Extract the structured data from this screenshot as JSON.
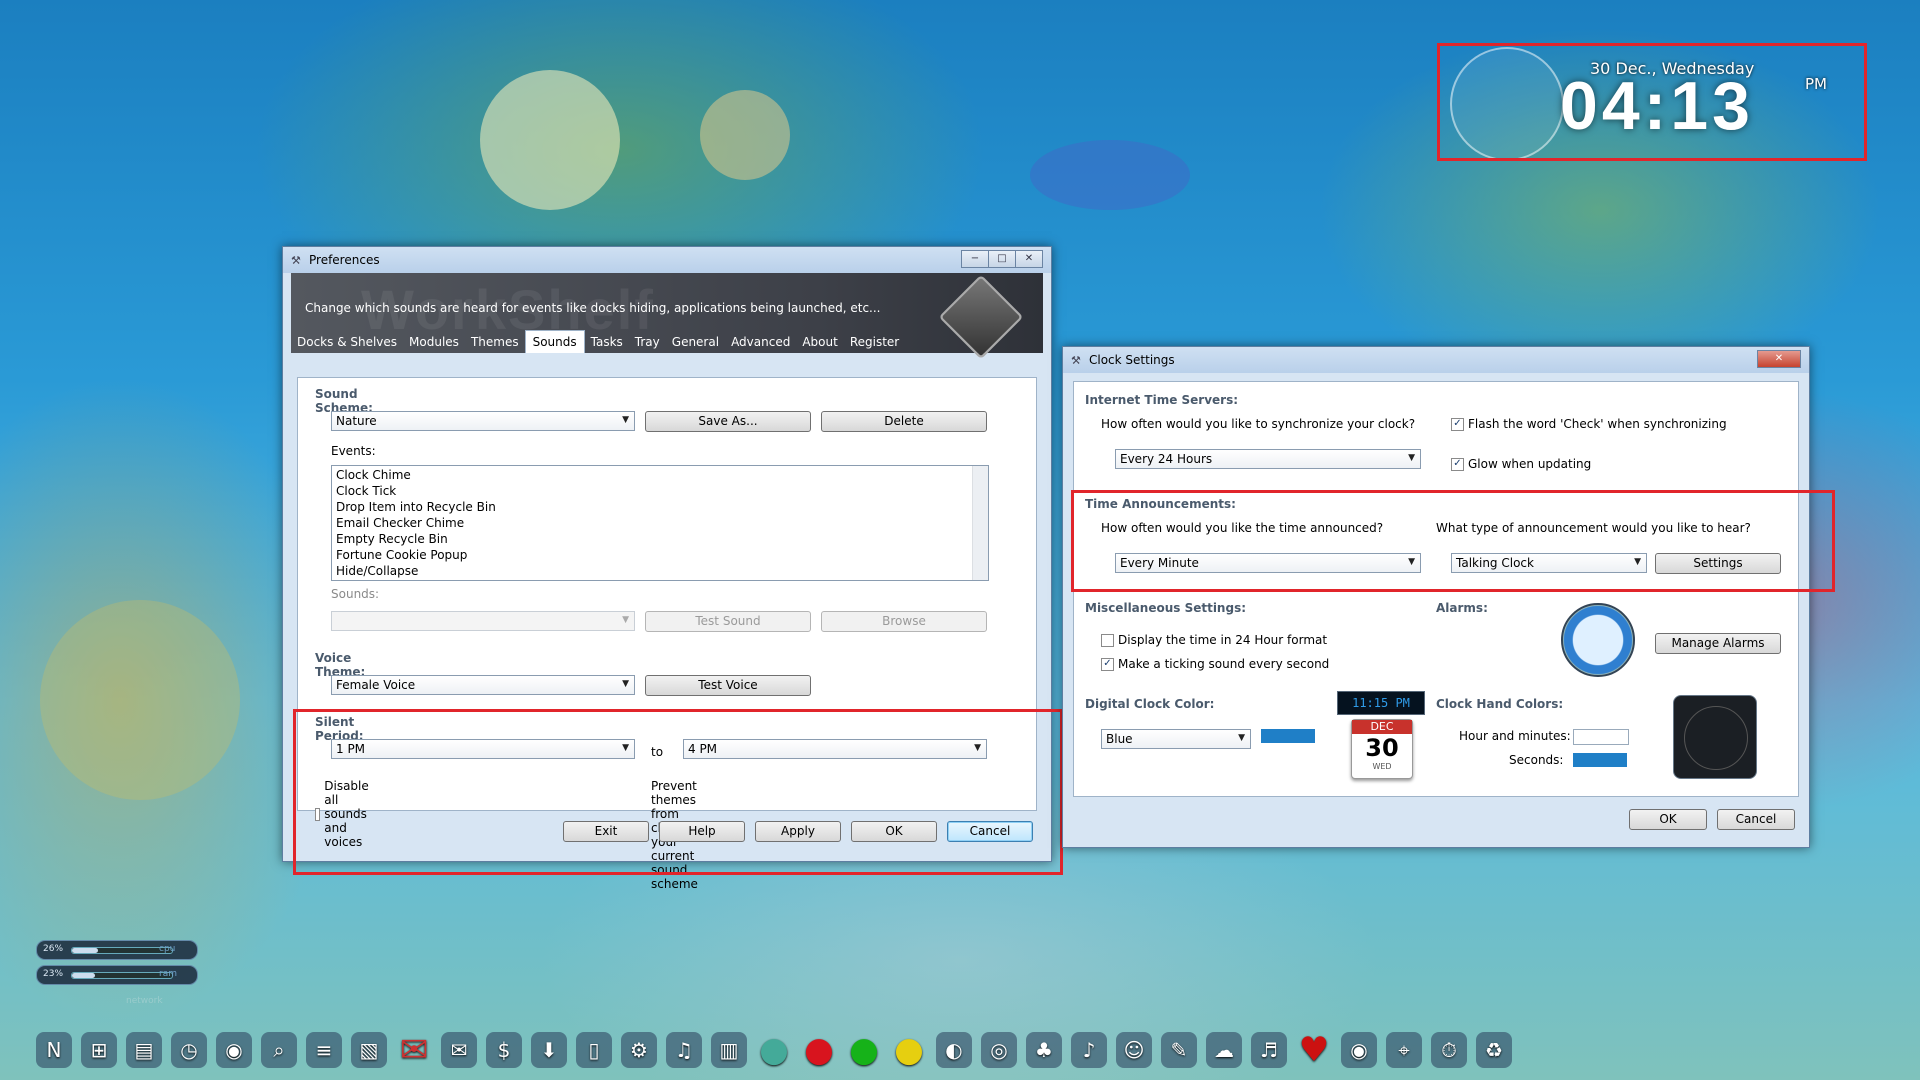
{
  "desktop_clock": {
    "date": "30 Dec., Wednesday",
    "time": "04:13",
    "ampm": "PM"
  },
  "preferences": {
    "title": "Preferences",
    "banner_watermark": "WorkShelf",
    "banner_text": "Change which sounds are heard for events like docks hiding, applications being launched, etc...",
    "tabs": [
      "Docks & Shelves",
      "Modules",
      "Themes",
      "Sounds",
      "Tasks",
      "Tray",
      "General",
      "Advanced",
      "About",
      "Register"
    ],
    "active_tab": "Sounds",
    "sound_scheme_label": "Sound Scheme:",
    "sound_scheme_value": "Nature",
    "save_as_button": "Save As...",
    "delete_button": "Delete",
    "events_label": "Events:",
    "events": [
      "Clock Chime",
      "Clock Tick",
      "Drop Item into Recycle Bin",
      "Email Checker Chime",
      "Empty Recycle Bin",
      "Fortune Cookie Popup",
      "Hide/Collapse"
    ],
    "sounds_label": "Sounds:",
    "sounds_value": "",
    "test_sound_button": "Test Sound",
    "browse_button": "Browse",
    "voice_theme_label": "Voice Theme:",
    "voice_theme_value": "Female Voice",
    "test_voice_button": "Test Voice",
    "silent_period_label": "Silent Period:",
    "silent_from": "1 PM",
    "to_label": "to",
    "silent_to": "4 PM",
    "disable_sounds": {
      "label": "Disable all sounds and voices",
      "checked": false
    },
    "prevent_themes": {
      "label": "Prevent themes from changing your current sound scheme",
      "checked": false
    },
    "buttons": {
      "exit": "Exit",
      "help": "Help",
      "apply": "Apply",
      "ok": "OK",
      "cancel": "Cancel"
    }
  },
  "clock_settings": {
    "title": "Clock Settings",
    "internet_time_label": "Internet Time Servers:",
    "sync_question": "How often would you like to synchronize your clock?",
    "sync_value": "Every 24 Hours",
    "flash_check": {
      "label": "Flash the word 'Check' when synchronizing",
      "checked": true
    },
    "glow_updating": {
      "label": "Glow when updating",
      "checked": true
    },
    "time_announcements_label": "Time Announcements:",
    "announce_question": "How often would you like the time announced?",
    "announce_value": "Every Minute",
    "announce_type_question": "What type of announcement would you like to hear?",
    "announce_type_value": "Talking Clock",
    "settings_button": "Settings",
    "misc_label": "Miscellaneous Settings:",
    "display_24h": {
      "label": "Display the time in 24 Hour format",
      "checked": false
    },
    "ticking_sound": {
      "label": "Make a ticking sound every second",
      "checked": true
    },
    "alarms_label": "Alarms:",
    "manage_alarms_button": "Manage Alarms",
    "digital_color_label": "Digital Clock Color:",
    "digital_color_value": "Blue",
    "digital_preview": "11:15 PM",
    "calendar": {
      "month": "DEC",
      "day": "30",
      "weekday": "WED"
    },
    "hand_colors_label": "Clock Hand Colors:",
    "hour_minutes_label": "Hour and minutes:",
    "seconds_label": "Seconds:",
    "ok_button": "OK",
    "cancel_button": "Cancel",
    "colors": {
      "digital": "#1f7fc7",
      "hour_minutes": "#ffffff",
      "seconds": "#1f7fc7"
    }
  },
  "meters": [
    {
      "percent": "26%",
      "name": "cpu",
      "level": 0.26
    },
    {
      "percent": "23%",
      "name": "ram",
      "level": 0.23
    }
  ],
  "network_label": "network",
  "dock_icons": [
    "nexus-icon",
    "windows-icon",
    "folder-icon",
    "clock-icon",
    "speaker-icon",
    "search-icon",
    "notepad-icon",
    "sticky-notes-icon",
    "gmail-icon",
    "yahoo-mail-icon",
    "bills-icon",
    "download-icon",
    "document-icon",
    "gear-icon",
    "music-icon",
    "tuner-icon",
    "windows-orb-icon",
    "red-ball-icon",
    "green-ball-icon",
    "yellow-ball-icon",
    "firefox-icon",
    "chrome-icon",
    "games-icon",
    "microphone-icon",
    "panda-icon",
    "paint-icon",
    "weather-icon",
    "itunes-icon",
    "heart-icon",
    "camera-icon",
    "safari-icon",
    "stopwatch-icon",
    "recycle-bin-icon"
  ],
  "dock_labels": {
    "nexus": "Nexus",
    "gmail": "Gmail",
    "yahoo": "YAHOO!",
    "bills": "Bills",
    "tuner": "Tuner"
  },
  "highlight_color": "#e1252b"
}
